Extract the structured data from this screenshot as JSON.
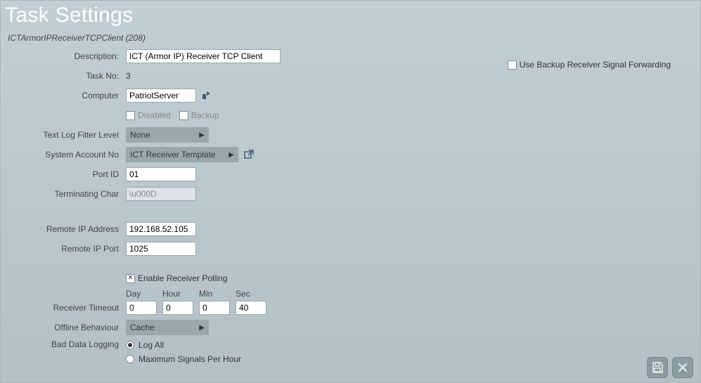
{
  "title": "Task Settings",
  "subtitle": "ICTArmorIPReceiverTCPClient (208)",
  "labels": {
    "description": "Description:",
    "task_no": "Task No:",
    "computer": "Computer",
    "disabled": "Disabled",
    "backup": "Backup",
    "text_log_filter_level": "Text Log Filter Level",
    "system_account_no": "System Account No",
    "port_id": "Port ID",
    "terminating_char": "Terminating Char",
    "remote_ip_address": "Remote IP Address",
    "remote_ip_port": "Remote IP Port",
    "enable_receiver_polling": "Enable Receiver Polling",
    "day": "Day",
    "hour": "Hour",
    "min": "Min",
    "sec": "Sec",
    "receiver_timeout": "Receiver Timeout",
    "offline_behaviour": "Offline Behaviour",
    "bad_data_logging": "Bad Data Logging",
    "log_all": "Log All",
    "max_signals_per_hour": "Maximum Signals Per Hour",
    "use_backup_receiver": "Use Backup Receiver Signal Forwarding"
  },
  "values": {
    "description": "ICT (Armor IP) Receiver TCP Client",
    "task_no": "3",
    "computer": "PatriotServer",
    "disabled": false,
    "backup": false,
    "text_log_filter_level": "None",
    "system_account_no": "ICT Receiver Template",
    "port_id": "01",
    "terminating_char": "\\u000D",
    "remote_ip_address": "192.168.52.105",
    "remote_ip_port": "1025",
    "enable_receiver_polling": true,
    "timeout": {
      "day": "0",
      "hour": "0",
      "min": "0",
      "sec": "40"
    },
    "offline_behaviour": "Cache",
    "bad_data_logging": "log_all",
    "use_backup_receiver": false
  }
}
